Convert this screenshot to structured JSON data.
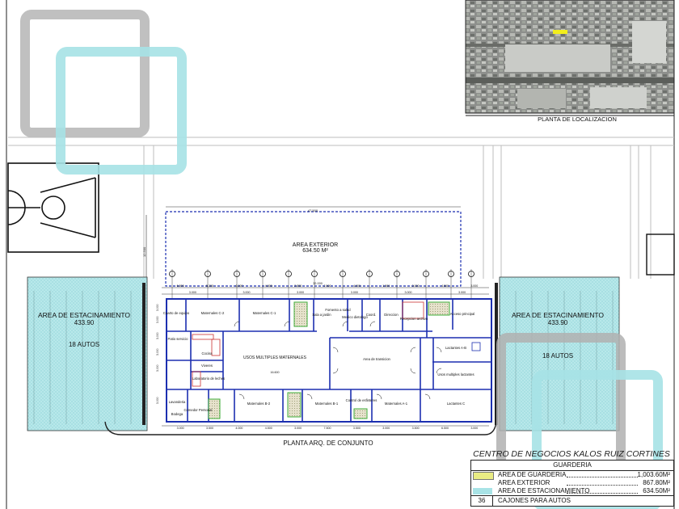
{
  "colors": {
    "wall_blue": "#1c2fb0",
    "parking_cyan": "#a8e3e6",
    "guarderia_yellow": "#e9ec84",
    "overlay_gray": "#b9b9b9",
    "overlay_cyan": "#a6e2e6",
    "column_green": "#3fae3a",
    "line_dark": "#222222"
  },
  "location": {
    "title": "PLANTA DE LOCALIZACION"
  },
  "site": {
    "exterior_label": "AREA EXTERIOR",
    "exterior_area": "634.50 M²",
    "plan_title": "PLANTA ARQ. DE CONJUNTO",
    "dim_top": "47.500",
    "dim_side": "12.500"
  },
  "parking_left": {
    "label": "AREA DE ESTACINAMIENTO",
    "area": "433.90",
    "cars": "18 AUTOS"
  },
  "parking_right": {
    "label": "AREA DE ESTACINAMIENTO",
    "area": "433.90",
    "cars": "18 AUTOS"
  },
  "rooms": {
    "cuarto_equipo": "Cuarto de equipo",
    "maternales_c2": "Maternales C-2",
    "maternales_c1": "Maternales C-1",
    "sala_jardin": "Sala a jardin",
    "fomento_salud": "Fomento a salud",
    "medico": "Medico dietologo",
    "coord": "Coord.",
    "direccion": "Direccion",
    "recepcion": "Recepcion archivo",
    "acceso": "Acceso principal",
    "patio": "Patio servicio",
    "cocina": "Cocina",
    "viveres": "Viveres",
    "lab_leches": "Laboratorio de leches",
    "usos_multiples_mat": "USOS MULTIPLES MATERNALES",
    "area_transicion": "Area de transicion",
    "lactantes_ab": "Lactantes A-B",
    "usos_lactantes": "Usos multiples lactantes",
    "lavanderia": "Lavanderia",
    "bodega": "Bodega",
    "comedor": "Comedor Personal",
    "maternales_b2": "Maternales B-2",
    "maternales_b1": "Maternales B-1",
    "control_esfinteres": "Control de esfinteres",
    "maternales_a1": "Maternales A-1",
    "lactantes_c": "Lactantes C"
  },
  "dims": {
    "top_row": [
      "6.500",
      "5.300",
      "6.000",
      "4.000",
      "2.800",
      "2.500",
      "4.000",
      "1.500",
      "3.000",
      "4.500",
      "3.000"
    ],
    "second_row": [
      "3.000",
      "3.000",
      "3.000",
      "3.000",
      "3.000",
      "3.000"
    ],
    "bottom_row": [
      "3.000",
      "3.500",
      "4.000",
      "4.500",
      "3.000",
      "7.500",
      "3.500",
      "3.000",
      "3.500",
      "6.500",
      "3.000"
    ],
    "center": "32.000",
    "mid_width": "16.600",
    "left_col": [
      "3.000",
      "3.000",
      "3.000",
      "3.000",
      "3.000",
      "3.000"
    ]
  },
  "title_block": {
    "project": "CENTRO DE NEGOCIOS KALOS RUIZ CORTINES",
    "building": "GUARDERIA",
    "rows": [
      {
        "name": "AREA DE GUARDERIA",
        "value": "1,003.60M²",
        "color": "#e9ec84"
      },
      {
        "name": "AREA EXTERIOR",
        "value": "867.80M²",
        "color": "#ffffff"
      },
      {
        "name": "AREA DE ESTACIONAMIENTO",
        "value": "634.50M²",
        "color": "#a8e3e6"
      }
    ],
    "cars_count": "36",
    "cars_label": "CAJONES PARA AUTOS"
  }
}
